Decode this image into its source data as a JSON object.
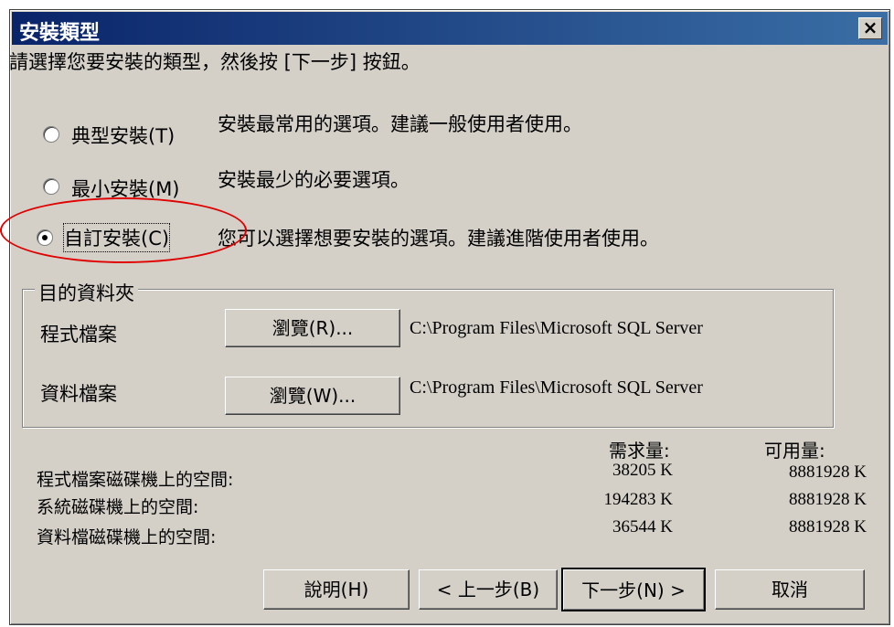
{
  "window": {
    "title": "安裝類型",
    "close_label": "×"
  },
  "instruction": "請選擇您要安裝的類型，然後按 [下一步] 按鈕。",
  "options": [
    {
      "label": "典型安裝(T)",
      "description": "安裝最常用的選項。建議一般使用者使用。",
      "selected": false
    },
    {
      "label": "最小安裝(M)",
      "description": "安裝最少的必要選項。",
      "selected": false
    },
    {
      "label": "自訂安裝(C)",
      "description": "您可以選擇想要安裝的選項。建議進階使用者使用。",
      "selected": true
    }
  ],
  "destination": {
    "legend": "目的資料夾",
    "rows": [
      {
        "label": "程式檔案",
        "button": "瀏覽(R)...",
        "path": "C:\\Program Files\\Microsoft SQL Server"
      },
      {
        "label": "資料檔案",
        "button": "瀏覽(W)...",
        "path": "C:\\Program Files\\Microsoft SQL Server"
      }
    ]
  },
  "space": {
    "required_header": "需求量:",
    "available_header": "可用量:",
    "rows": [
      {
        "label": "程式檔案磁碟機上的空間:",
        "required": "38205 K",
        "available": "8881928 K"
      },
      {
        "label": "系統磁碟機上的空間:",
        "required": "194283 K",
        "available": "8881928 K"
      },
      {
        "label": "資料檔磁碟機上的空間:",
        "required": "36544 K",
        "available": "8881928 K"
      }
    ]
  },
  "buttons": {
    "help": "說明(H)",
    "back": "< 上一步(B)",
    "next": "下一步(N) >",
    "cancel": "取消"
  },
  "colors": {
    "title_bar": "#0a246a",
    "dialog_bg": "#d4d0c8",
    "annotation": "#e00000"
  }
}
